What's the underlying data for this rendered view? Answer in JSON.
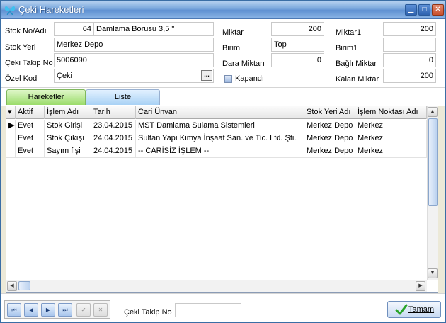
{
  "window": {
    "title": "Çeki Hareketleri"
  },
  "form": {
    "stok_no_label": "Stok No/Adı",
    "stok_no_value": "64",
    "stok_adi_value": "Damlama Borusu 3,5 \"",
    "stok_yeri_label": "Stok Yeri",
    "stok_yeri_value": "Merkez Depo",
    "ceki_takip_label": "Çeki Takip No",
    "ceki_takip_value": "5006090",
    "ozel_kod_label": "Özel Kod",
    "ozel_kod_value": "Çeki",
    "ellipsis_label": "...",
    "miktar_label": "Miktar",
    "miktar_value": "200",
    "birim_label": "Birim",
    "birim_value": "Top",
    "dara_label": "Dara Miktarı",
    "dara_value": "0",
    "kapandi_label": "Kapandı",
    "miktar1_label": "Miktar1",
    "miktar1_value": "200",
    "birim1_label": "Birim1",
    "birim1_value": "",
    "bagli_label": "Bağlı Miktar",
    "bagli_value": "0",
    "kalan_label": "Kalan Miktar",
    "kalan_value": "200"
  },
  "tabs": [
    {
      "label": "Hareketler",
      "active": true
    },
    {
      "label": "Liste",
      "active": false
    }
  ],
  "grid": {
    "columns": [
      "Aktif",
      "İşlem Adı",
      "Tarih",
      "Cari Ünvanı",
      "Stok Yeri Adı",
      "İşlem Noktası Adı"
    ],
    "rows": [
      [
        "Evet",
        "Stok Girişi",
        "23.04.2015",
        "MST Damlama Sulama Sistemleri",
        "Merkez Depo",
        "Merkez"
      ],
      [
        "Evet",
        "Stok Çıkışı",
        "24.04.2015",
        "Sultan Yapı Kimya İnşaat San. ve Tic. Ltd. Şti.",
        "Merkez Depo",
        "Merkez"
      ],
      [
        "Evet",
        "Sayım fişi",
        "24.04.2015",
        "-- CARİSİZ İŞLEM --",
        "Merkez Depo",
        "Merkez"
      ]
    ]
  },
  "bottom": {
    "ceki_takip_label": "Çeki Takip No",
    "ceki_takip_value": "",
    "ok_label": "Tamam"
  },
  "colors": {
    "title_bar": "#5e90d2",
    "active_tab": "#9bdc6b",
    "inactive_tab": "#a9d2f5"
  },
  "icons": [
    "butterfly-icon",
    "minimize-icon",
    "maximize-icon",
    "close-icon",
    "ellipsis-icon",
    "first-icon",
    "prev-icon",
    "next-icon",
    "last-icon",
    "check-icon",
    "cancel-icon",
    "ok-check-icon",
    "row-indicator-icon",
    "column-menu-icon"
  ]
}
